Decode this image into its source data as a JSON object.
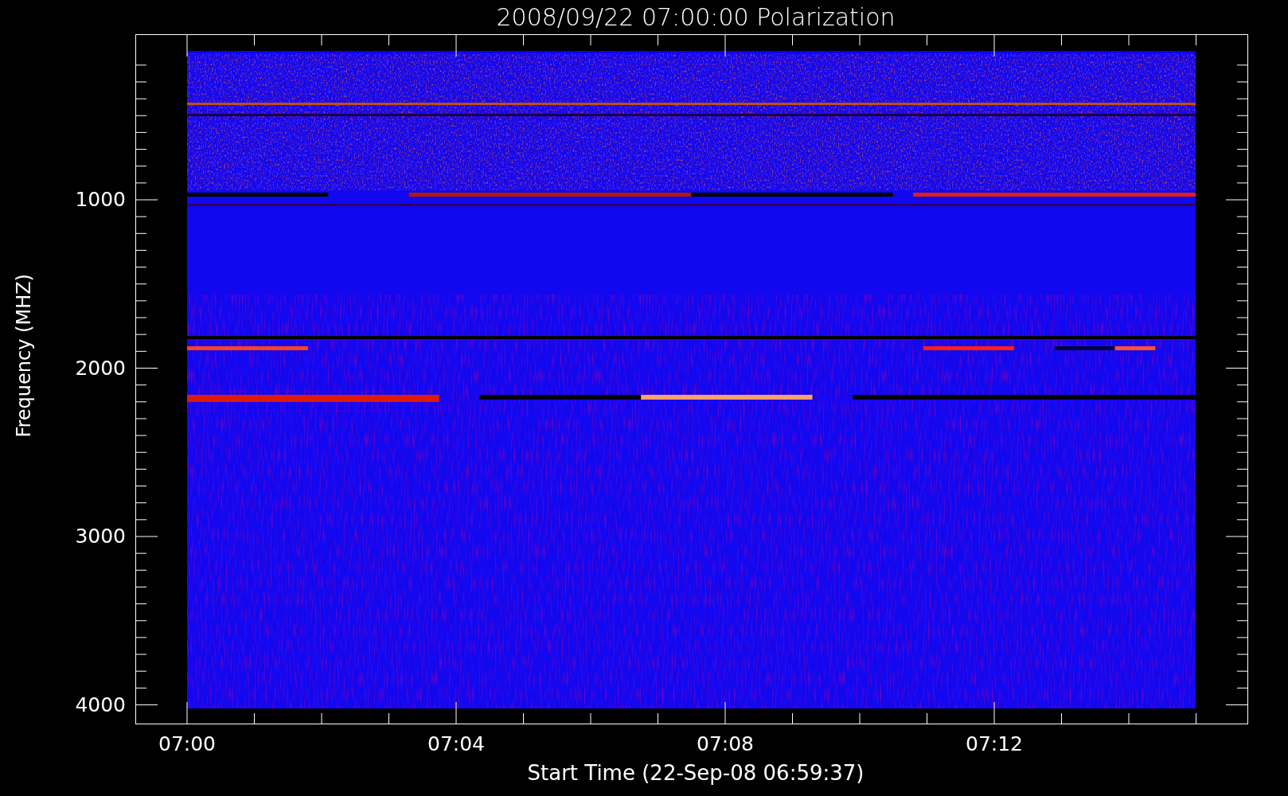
{
  "title": "2008/09/22 07:00:00 Polarization",
  "y_axis": {
    "label": "Frequency (MHZ)",
    "ticks": [
      "1000",
      "2000",
      "3000",
      "4000"
    ]
  },
  "x_axis": {
    "label": "Start Time (22-Sep-08 06:59:37)",
    "ticks": [
      "07:00",
      "07:04",
      "07:08",
      "07:12"
    ]
  }
}
